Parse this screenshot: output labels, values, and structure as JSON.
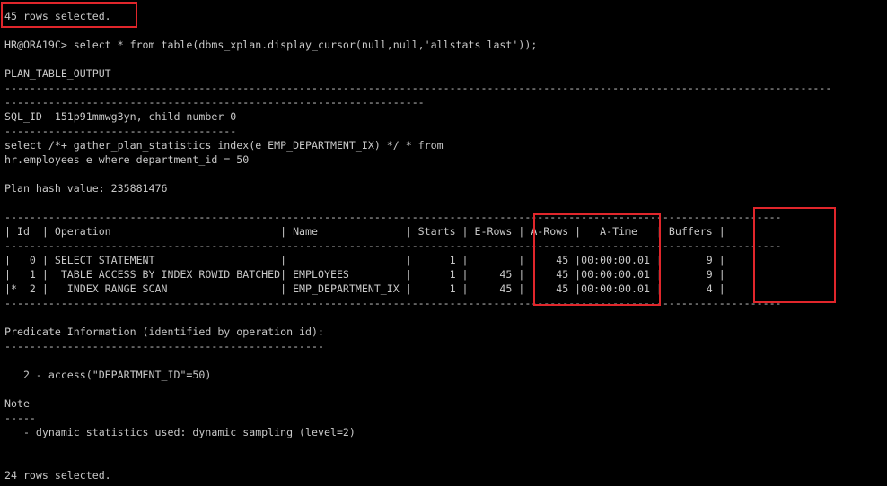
{
  "highlight_color": "#e0262b",
  "terminal": {
    "lines": [
      "45 rows selected.",
      "",
      "HR@ORA19C> select * from table(dbms_xplan.display_cursor(null,null,'allstats last'));",
      "",
      "PLAN_TABLE_OUTPUT",
      "------------------------------------------------------------------------------------------------------------------------------------",
      "-------------------------------------------------------------------",
      "SQL_ID  151p91mmwg3yn, child number 0",
      "-------------------------------------",
      "select /*+ gather_plan_statistics index(e EMP_DEPARTMENT_IX) */ * from",
      "hr.employees e where department_id = 50",
      "",
      "Plan hash value: 235881476",
      "",
      "----------------------------------------------------------------------------------------------------------------------------",
      "| Id  | Operation                           | Name              | Starts | E-Rows | A-Rows |   A-Time   | Buffers |",
      "----------------------------------------------------------------------------------------------------------------------------",
      "|   0 | SELECT STATEMENT                    |                   |      1 |        |     45 |00:00:00.01 |       9 |",
      "|   1 |  TABLE ACCESS BY INDEX ROWID BATCHED| EMPLOYEES         |      1 |     45 |     45 |00:00:00.01 |       9 |",
      "|*  2 |   INDEX RANGE SCAN                  | EMP_DEPARTMENT_IX |      1 |     45 |     45 |00:00:00.01 |       4 |",
      "----------------------------------------------------------------------------------------------------------------------------",
      "",
      "Predicate Information (identified by operation id):",
      "---------------------------------------------------",
      "",
      "   2 - access(\"DEPARTMENT_ID\"=50)",
      "",
      "Note",
      "-----",
      "   - dynamic statistics used: dynamic sampling (level=2)",
      "",
      "",
      "24 rows selected."
    ]
  }
}
